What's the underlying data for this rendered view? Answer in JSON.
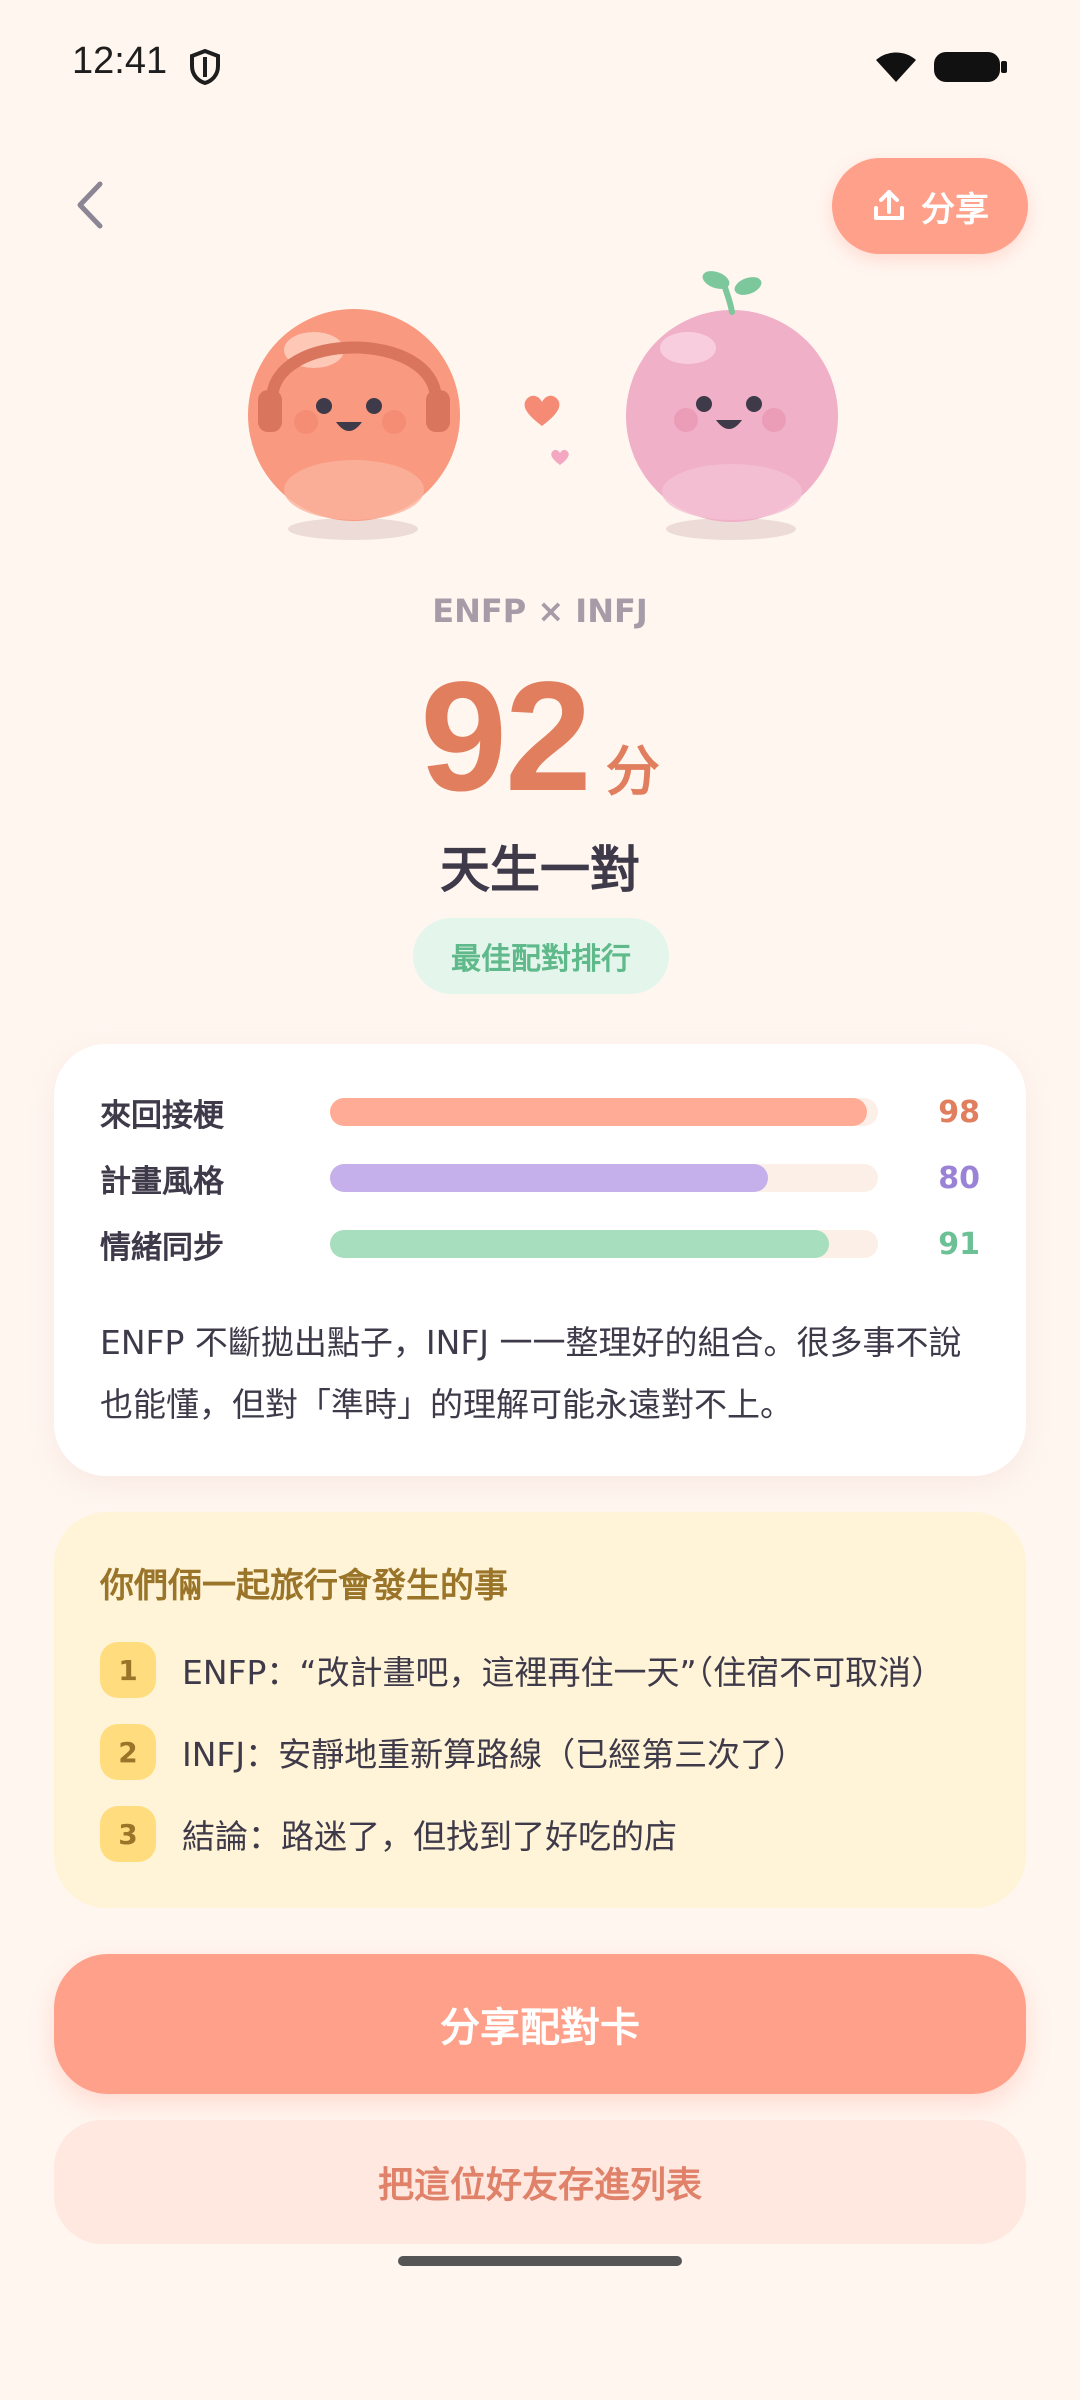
{
  "status_bar": {
    "time": "12:41"
  },
  "header": {
    "share_label": "分享"
  },
  "match": {
    "pair": "ENFP × INFJ",
    "score": "92",
    "score_unit": "分",
    "title": "天生一對",
    "rank_label": "最佳配對排行"
  },
  "stats": {
    "items": [
      {
        "label": "來回接梗",
        "value": "98",
        "fraction": 0.98,
        "color": "#FFAB95",
        "value_color": "#E07E5E"
      },
      {
        "label": "計畫風格",
        "value": "80",
        "fraction": 0.8,
        "color": "#C6B0EC",
        "value_color": "#9A83D6"
      },
      {
        "label": "情緒同步",
        "value": "91",
        "fraction": 0.91,
        "color": "#A7DFBE",
        "value_color": "#6CC095"
      }
    ],
    "description": "ENFP 不斷拋出點子，INFJ 一一整理好的組合。很多事不說也能懂，但對「準時」的理解可能永遠對不上。"
  },
  "travel": {
    "title": "你們倆一起旅行會發生的事",
    "items": [
      {
        "num": "1",
        "text": "ENFP：“改計畫吧，這裡再住一天”（住宿不可取消）"
      },
      {
        "num": "2",
        "text": "INFJ：安靜地重新算路線（已經第三次了）"
      },
      {
        "num": "3",
        "text": "結論：路迷了，但找到了好吃的店"
      }
    ]
  },
  "actions": {
    "share_card": "分享配對卡",
    "save_friend": "把這位好友存進列表"
  }
}
